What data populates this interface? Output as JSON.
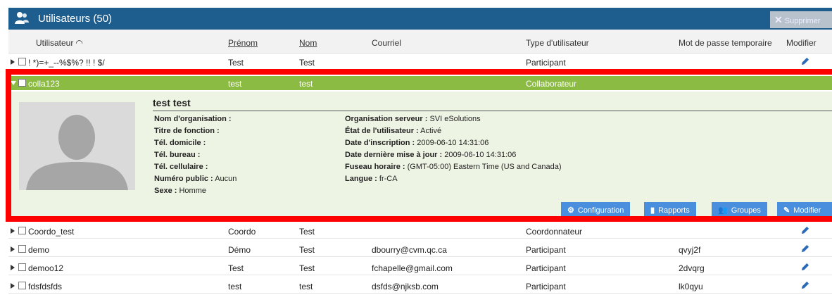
{
  "header": {
    "title": "Utilisateurs (50)",
    "delete_label": "Supprimer",
    "bg_color": "#1d5e8e"
  },
  "columns": {
    "user": "Utilisateur",
    "first": "Prénom",
    "last": "Nom",
    "email": "Courriel",
    "type": "Type d'utilisateur",
    "temp_password": "Mot de passe temporaire",
    "edit": "Modifier"
  },
  "rows": [
    {
      "user": "! *)=+_--%$%? !! ! $/",
      "first": "Test",
      "last": "Test",
      "email": "",
      "type": "Participant",
      "temp_password": ""
    },
    {
      "user": "colla123",
      "first": "test",
      "last": "test",
      "email": "",
      "type": "Collaborateur",
      "temp_password": ""
    },
    {
      "user": "Coordo_test",
      "first": "Coordo",
      "last": "Test",
      "email": "",
      "type": "Coordonnateur",
      "temp_password": ""
    },
    {
      "user": "demo",
      "first": "Démo",
      "last": "Test",
      "email": "dbourry@cvm.qc.ca",
      "type": "Participant",
      "temp_password": "qvyj2f"
    },
    {
      "user": "demoo12",
      "first": "Test",
      "last": "Test",
      "email": "fchapelle@gmail.com",
      "type": "Participant",
      "temp_password": "2dvqrg"
    },
    {
      "user": "fdsfdsfds",
      "first": "test",
      "last": "test",
      "email": "dsfds@njksb.com",
      "type": "Participant",
      "temp_password": "lk0qyu"
    }
  ],
  "details": {
    "name": "test test",
    "left": [
      {
        "label": "Nom d'organisation :",
        "value": ""
      },
      {
        "label": "Titre de fonction :",
        "value": ""
      },
      {
        "label": "Tél. domicile :",
        "value": ""
      },
      {
        "label": "Tél. bureau :",
        "value": ""
      },
      {
        "label": "Tél. cellulaire :",
        "value": ""
      },
      {
        "label": "Numéro public :",
        "value": "Aucun"
      },
      {
        "label": "Sexe :",
        "value": "Homme"
      }
    ],
    "right": [
      {
        "label": "Organisation serveur :",
        "value": "SVI eSolutions"
      },
      {
        "label": "État de l'utilisateur :",
        "value": "Activé"
      },
      {
        "label": "Date d'inscription :",
        "value": "2009-06-10 14:31:06"
      },
      {
        "label": "Date dernière mise à jour :",
        "value": "2009-06-10 14:31:06"
      },
      {
        "label": "Fuseau horaire :",
        "value": "(GMT-05:00) Eastern Time (US and Canada)"
      },
      {
        "label": "Langue :",
        "value": "fr-CA"
      }
    ],
    "buttons": {
      "config": "Configuration",
      "reports": "Rapports",
      "groups": "Groupes",
      "edit": "Modifier"
    }
  },
  "colors": {
    "selected_row": "#8bbb42",
    "detail_bg": "#eef4e4",
    "action_button": "#4a8fdd",
    "highlight_border": "#ff0000"
  }
}
